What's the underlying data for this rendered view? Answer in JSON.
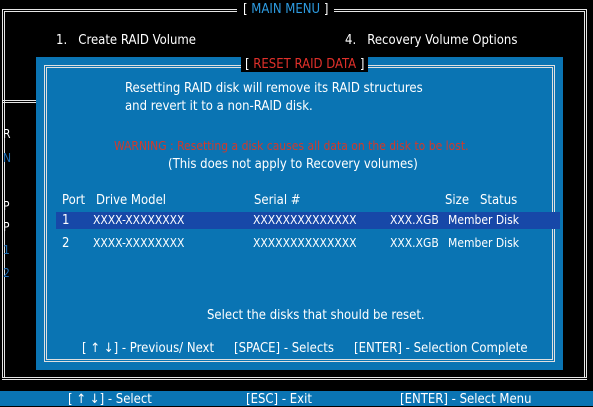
{
  "main_menu": {
    "title": "MAIN MENU",
    "bracket_open": "[",
    "bracket_close": "]",
    "items": [
      {
        "num": "1.",
        "label": "Create RAID Volume"
      },
      {
        "num": "4.",
        "label": "Recovery Volume Options"
      }
    ],
    "background_letters": [
      "R",
      "N",
      "P",
      "P",
      "1",
      "2"
    ]
  },
  "dialog": {
    "title": "RESET RAID DATA",
    "bracket_open": "[",
    "bracket_close": "]",
    "info_line1": "Resetting RAID disk will remove its RAID structures",
    "info_line2": "and revert it to a non-RAID disk.",
    "warning": "WARNING : Resetting a disk causes all data on the disk to be lost.",
    "note": "(This does not apply to Recovery volumes)",
    "columns": {
      "port": "Port",
      "drive_model": "Drive Model",
      "serial": "Serial #",
      "size": "Size",
      "status": "Status"
    },
    "rows": [
      {
        "port": "1",
        "model": "XXXX-XXXXXXXX",
        "serial": "XXXXXXXXXXXXXX",
        "size": "XXX.XGB",
        "status": "Member Disk"
      },
      {
        "port": "2",
        "model": "XXXX-XXXXXXXX",
        "serial": "XXXXXXXXXXXXXX",
        "size": "XXX.XGB",
        "status": "Member Disk"
      }
    ],
    "prompt": "Select the disks that should be reset.",
    "help": {
      "nav": "[ ↑ ↓] - Previous/ Next",
      "space": "[SPACE] - Selects",
      "enter": "[ENTER] - Selection Complete"
    }
  },
  "bottom_bar": {
    "select": "[ ↑ ↓] - Select",
    "exit": "[ESC] - Exit",
    "enter": "[ENTER] - Select Menu"
  },
  "colors": {
    "dialog_blue": "#0a74b3",
    "highlight": "#1748a8",
    "title_blue": "#2d9be0",
    "warning_red": "#d23a2a"
  }
}
